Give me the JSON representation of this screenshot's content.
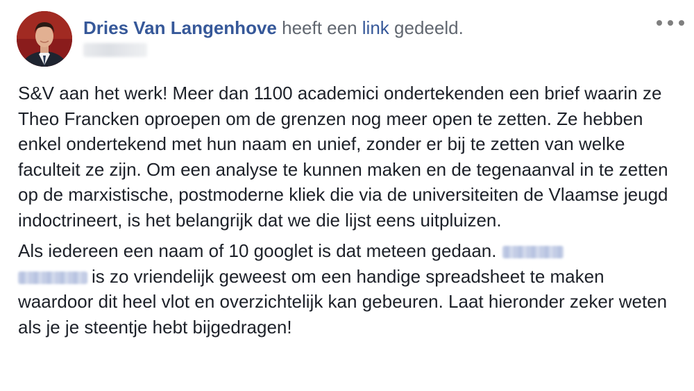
{
  "post": {
    "author": "Dries Van Langenhove",
    "action_before": "heeft een",
    "action_link": "link",
    "action_after": "gedeeld.",
    "paragraph1": "S&V aan het werk! Meer dan 1100 academici ondertekenden een brief waarin ze Theo Francken oproepen om de grenzen nog meer open te zetten. Ze hebben enkel ondertekend met hun naam en unief, zonder er bij te zetten van welke faculteit ze zijn. Om een analyse te kunnen maken en de tegenaanval in te zetten op de marxistische, postmoderne kliek die via de universiteiten de Vlaamse jeugd indoctrineert, is het belangrijk dat we die lijst eens uitpluizen.",
    "paragraph2_start": "Als iedereen een naam of 10 googlet is dat meteen gedaan.",
    "paragraph2_end": "is zo vriendelijk geweest om een handige spreadsheet te maken waardoor dit heel vlot en overzichtelijk kan gebeuren. Laat hieronder zeker weten als je je steentje hebt bijgedragen!"
  },
  "icons": {
    "more": "more-horizontal-icon",
    "avatar": "profile-photo"
  },
  "colors": {
    "link": "#365899",
    "text": "#1d2129",
    "meta": "#616770"
  }
}
